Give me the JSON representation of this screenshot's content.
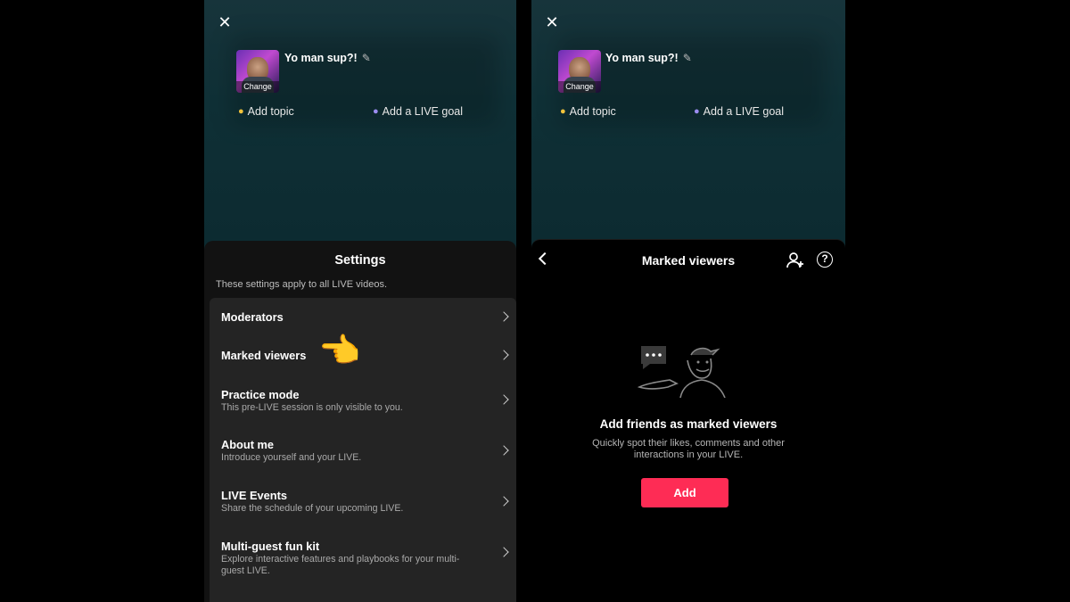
{
  "left": {
    "live_title": "Yo man sup?!",
    "cover_change": "Change",
    "add_topic": "Add topic",
    "add_goal": "Add a LIVE goal",
    "close_symbol": "✕",
    "pencil_symbol": "✎",
    "settings_title": "Settings",
    "settings_subtitle": "These settings apply to all LIVE videos.",
    "items": [
      {
        "label": "Moderators",
        "desc": ""
      },
      {
        "label": "Marked viewers",
        "desc": ""
      },
      {
        "label": "Practice mode",
        "desc": "This pre-LIVE session is only visible to you."
      },
      {
        "label": "About me",
        "desc": "Introduce yourself and your LIVE."
      },
      {
        "label": "LIVE Events",
        "desc": "Share the schedule of your upcoming LIVE."
      },
      {
        "label": "Multi-guest fun kit",
        "desc": "Explore interactive features and playbooks for your multi-guest LIVE."
      }
    ],
    "hand_emoji": "👈"
  },
  "right": {
    "live_title": "Yo man sup?!",
    "cover_change": "Change",
    "add_topic": "Add topic",
    "add_goal": "Add a LIVE goal",
    "close_symbol": "✕",
    "pencil_symbol": "✎",
    "header_title": "Marked viewers",
    "help_symbol": "?",
    "empty_title": "Add friends as marked viewers",
    "empty_desc": "Quickly spot their likes, comments and other interactions in your LIVE.",
    "add_button": "Add"
  },
  "colors": {
    "accent": "#fe2c55",
    "list_bg": "#242424",
    "live_bg": "#0f3036"
  },
  "icons": [
    "close-icon",
    "pencil-icon",
    "topic-icon",
    "goal-icon",
    "chevron-right-icon",
    "pointing-hand-icon",
    "back-icon",
    "add-user-icon",
    "help-icon"
  ]
}
